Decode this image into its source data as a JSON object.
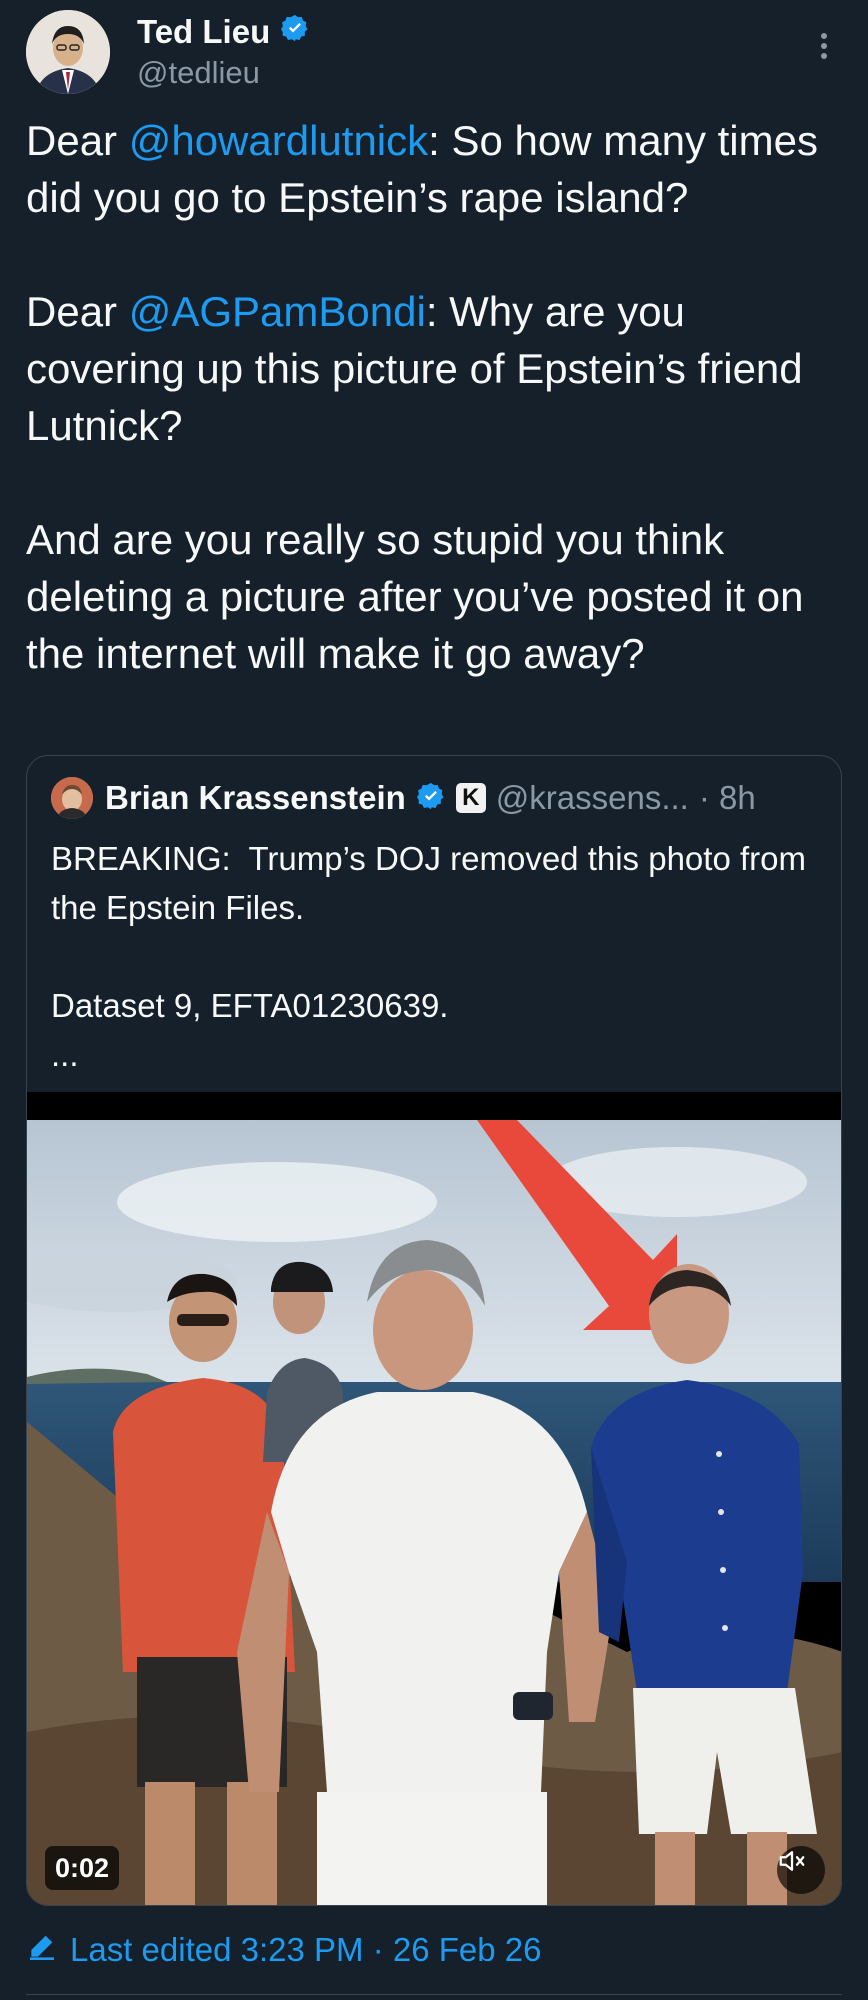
{
  "author": {
    "display_name": "Ted Lieu",
    "handle": "@tedlieu",
    "verified": true
  },
  "tweet": {
    "paragraph1": {
      "prefix": "Dear ",
      "mention": "@howardlutnick",
      "suffix": ": So how many times did you go to Epstein’s rape island?"
    },
    "paragraph2": {
      "prefix": "Dear ",
      "mention": "@AGPamBondi",
      "suffix": ": Why are you covering up this picture of Epstein’s friend Lutnick?"
    },
    "paragraph3": "And are you really so stupid you think deleting a picture after you’ve posted it on the internet will make it go away?"
  },
  "quoted_tweet": {
    "display_name": "Brian Krassenstein",
    "affiliate_badge": "K",
    "handle": "@krassens...",
    "time": "· 8h",
    "text": "BREAKING:  Trump’s DOJ removed this photo from the Epstein Files.\n\nDataset 9, EFTA01230639.\n...",
    "video_time": "0:02"
  },
  "footer": {
    "edited": "Last edited 3:23 PM · 26 Feb 26"
  },
  "colors": {
    "background": "#15202b",
    "accent": "#1d9bf0",
    "secondary_text": "#8b98a5",
    "border": "#38444d"
  },
  "icons": [
    "verified-badge-icon",
    "more-options-icon",
    "mute-icon",
    "edit-pencil-icon"
  ]
}
